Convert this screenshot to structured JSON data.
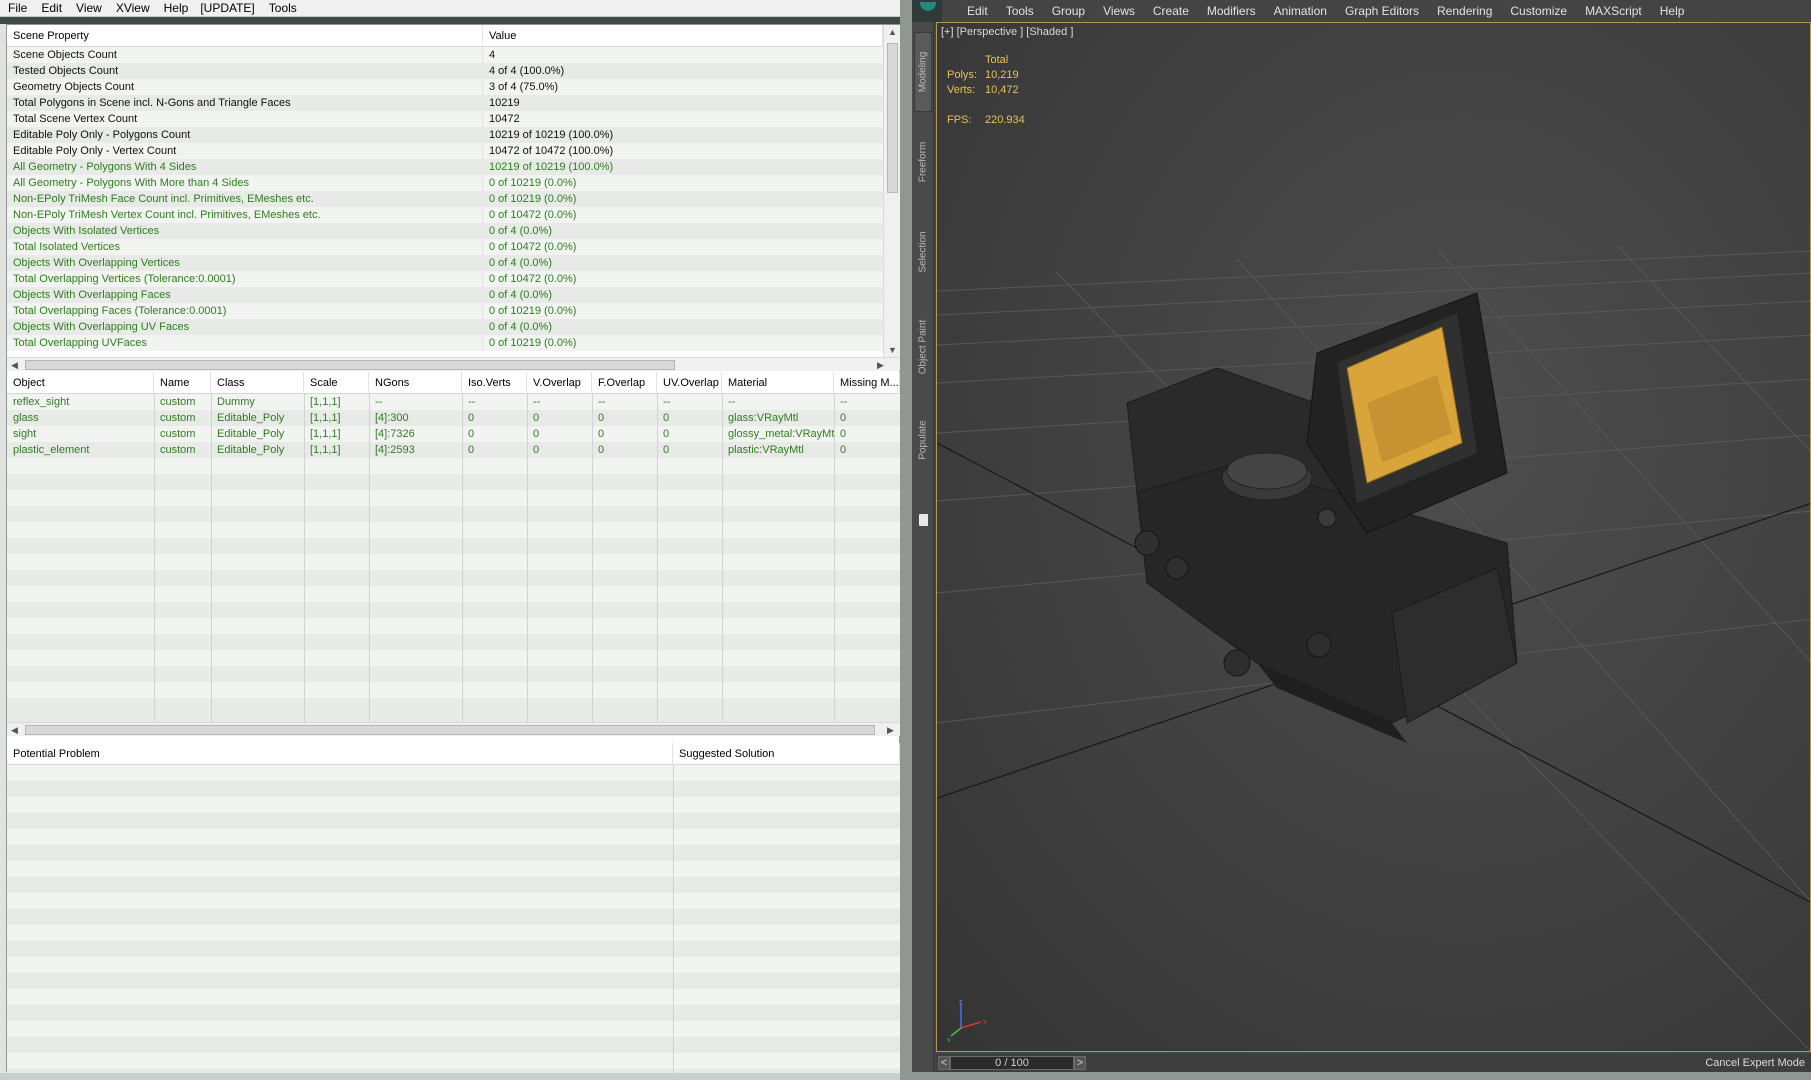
{
  "left_window": {
    "menu": [
      "File",
      "Edit",
      "View",
      "XView",
      "Help",
      "[UPDATE]",
      "Tools"
    ],
    "scene_grid": {
      "headers": [
        "Scene Property",
        "Value"
      ],
      "rows": [
        {
          "property": "Scene Objects Count",
          "value": "4",
          "color": "black"
        },
        {
          "property": "Tested Objects Count",
          "value": "4 of 4 (100.0%)",
          "color": "black"
        },
        {
          "property": "Geometry Objects Count",
          "value": "3 of 4 (75.0%)",
          "color": "black"
        },
        {
          "property": "Total Polygons in Scene incl. N-Gons and Triangle Faces",
          "value": "10219",
          "color": "black"
        },
        {
          "property": "Total Scene Vertex Count",
          "value": "10472",
          "color": "black"
        },
        {
          "property": "Editable Poly Only - Polygons Count",
          "value": "10219 of 10219 (100.0%)",
          "color": "black"
        },
        {
          "property": "Editable Poly Only - Vertex Count",
          "value": "10472 of 10472 (100.0%)",
          "color": "black"
        },
        {
          "property": "All Geometry - Polygons With 4 Sides",
          "value": "10219 of 10219 (100.0%)",
          "color": "green"
        },
        {
          "property": "All Geometry - Polygons With More than 4 Sides",
          "value": "0 of 10219 (0.0%)",
          "color": "green"
        },
        {
          "property": "Non-EPoly TriMesh Face Count incl. Primitives, EMeshes etc.",
          "value": "0 of 10219 (0.0%)",
          "color": "green"
        },
        {
          "property": "Non-EPoly TriMesh Vertex Count incl. Primitives, EMeshes etc.",
          "value": "0 of 10472 (0.0%)",
          "color": "green"
        },
        {
          "property": "Objects With Isolated Vertices",
          "value": "0 of 4 (0.0%)",
          "color": "green"
        },
        {
          "property": "Total Isolated Vertices",
          "value": "0 of 10472 (0.0%)",
          "color": "green"
        },
        {
          "property": "Objects With Overlapping Vertices",
          "value": "0 of 4 (0.0%)",
          "color": "green"
        },
        {
          "property": "Total Overlapping Vertices (Tolerance:0.0001)",
          "value": "0 of 10472 (0.0%)",
          "color": "green"
        },
        {
          "property": "Objects With Overlapping Faces",
          "value": "0 of 4 (0.0%)",
          "color": "green"
        },
        {
          "property": "Total Overlapping Faces (Tolerance:0.0001)",
          "value": "0 of 10219 (0.0%)",
          "color": "green"
        },
        {
          "property": "Objects With Overlapping UV Faces",
          "value": "0 of 4 (0.0%)",
          "color": "green"
        },
        {
          "property": "Total Overlapping UVFaces",
          "value": "0 of 10219 (0.0%)",
          "color": "green"
        }
      ]
    },
    "object_grid": {
      "headers": [
        "Object",
        "Name",
        "Class",
        "Scale",
        "NGons",
        "Iso.Verts",
        "V.Overlap",
        "F.Overlap",
        "UV.Overlap",
        "Material",
        "Missing M..."
      ],
      "rows": [
        [
          "reflex_sight",
          "custom",
          "Dummy",
          "[1,1,1]",
          "--",
          "--",
          "--",
          "--",
          "--",
          "--",
          "--"
        ],
        [
          "glass",
          "custom",
          "Editable_Poly",
          "[1,1,1]",
          "[4]:300",
          "0",
          "0",
          "0",
          "0",
          "glass:VRayMtl",
          "0"
        ],
        [
          "sight",
          "custom",
          "Editable_Poly",
          "[1,1,1]",
          "[4]:7326",
          "0",
          "0",
          "0",
          "0",
          "glossy_metal:VRayMtl",
          "0"
        ],
        [
          "plastic_element",
          "custom",
          "Editable_Poly",
          "[1,1,1]",
          "[4]:2593",
          "0",
          "0",
          "0",
          "0",
          "plastic:VRayMtl",
          "0"
        ]
      ]
    },
    "problem_grid": {
      "headers": [
        "Potential Problem",
        "Suggested Solution"
      ]
    }
  },
  "max_window": {
    "menu": [
      "Edit",
      "Tools",
      "Group",
      "Views",
      "Create",
      "Modifiers",
      "Animation",
      "Graph Editors",
      "Rendering",
      "Customize",
      "MAXScript",
      "Help"
    ],
    "ribbon_tabs": [
      "Modeling",
      "Freeform",
      "Selection",
      "Object Paint",
      "Populate"
    ],
    "viewport_label": "[+] [Perspective ] [Shaded ]",
    "stats": {
      "header": "Total",
      "polys_label": "Polys:",
      "polys": "10,219",
      "verts_label": "Verts:",
      "verts": "10,472",
      "fps_label": "FPS:",
      "fps": "220.934"
    },
    "gizmo_labels": {
      "z": "z",
      "x": "x",
      "y": "y"
    },
    "time_slider": "0 / 100",
    "time_prev": "<",
    "time_next": ">",
    "cancel_expert": "Cancel Expert Mode"
  },
  "colors": {
    "ok_green": "#2e7d1e",
    "stats_yellow": "#e8c15a",
    "viewport_border": "#b19a50",
    "lens_amber": "#d9a53a"
  }
}
